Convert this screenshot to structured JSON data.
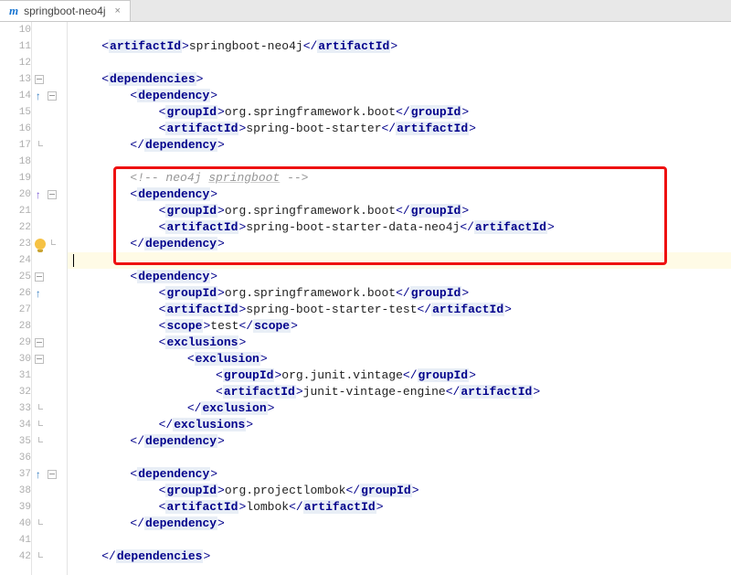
{
  "tab": {
    "icon": "m",
    "title": "springboot-neo4j",
    "close": "×"
  },
  "lines": [
    {
      "n": 10,
      "indent": 0,
      "parts": []
    },
    {
      "n": 11,
      "indent": 1,
      "parts": [
        {
          "k": "br",
          "v": "<"
        },
        {
          "k": "t",
          "v": "artifactId"
        },
        {
          "k": "br",
          "v": ">"
        },
        {
          "k": "tx",
          "v": "springboot-neo4j"
        },
        {
          "k": "br",
          "v": "</"
        },
        {
          "k": "t",
          "v": "artifactId"
        },
        {
          "k": "br",
          "v": ">"
        }
      ]
    },
    {
      "n": 12,
      "indent": 0,
      "parts": []
    },
    {
      "n": 13,
      "indent": 1,
      "fold": "minus",
      "parts": [
        {
          "k": "br",
          "v": "<"
        },
        {
          "k": "t",
          "v": "dependencies"
        },
        {
          "k": "br",
          "v": ">"
        }
      ]
    },
    {
      "n": 14,
      "indent": 2,
      "fold": "minus",
      "icon": "uparrow-blue",
      "parts": [
        {
          "k": "br",
          "v": "<"
        },
        {
          "k": "t",
          "v": "dependency"
        },
        {
          "k": "br",
          "v": ">"
        }
      ]
    },
    {
      "n": 15,
      "indent": 3,
      "parts": [
        {
          "k": "br",
          "v": "<"
        },
        {
          "k": "t",
          "v": "groupId"
        },
        {
          "k": "br",
          "v": ">"
        },
        {
          "k": "tx",
          "v": "org.springframework.boot"
        },
        {
          "k": "br",
          "v": "</"
        },
        {
          "k": "t",
          "v": "groupId"
        },
        {
          "k": "br",
          "v": ">"
        }
      ]
    },
    {
      "n": 16,
      "indent": 3,
      "parts": [
        {
          "k": "br",
          "v": "<"
        },
        {
          "k": "t",
          "v": "artifactId"
        },
        {
          "k": "br",
          "v": ">"
        },
        {
          "k": "tx",
          "v": "spring-boot-starter"
        },
        {
          "k": "br",
          "v": "</"
        },
        {
          "k": "t",
          "v": "artifactId"
        },
        {
          "k": "br",
          "v": ">"
        }
      ]
    },
    {
      "n": 17,
      "indent": 2,
      "foldend": true,
      "parts": [
        {
          "k": "br",
          "v": "</"
        },
        {
          "k": "t",
          "v": "dependency"
        },
        {
          "k": "br",
          "v": ">"
        }
      ]
    },
    {
      "n": 18,
      "indent": 0,
      "parts": []
    },
    {
      "n": 19,
      "indent": 2,
      "parts": [
        {
          "k": "cm",
          "v": "<!-- neo4j "
        },
        {
          "k": "cmu",
          "v": "springboot"
        },
        {
          "k": "cm",
          "v": " -->"
        }
      ]
    },
    {
      "n": 20,
      "indent": 2,
      "fold": "minus",
      "icon": "uparrow-purple",
      "parts": [
        {
          "k": "br",
          "v": "<"
        },
        {
          "k": "t",
          "v": "dependency"
        },
        {
          "k": "br",
          "v": ">"
        }
      ]
    },
    {
      "n": 21,
      "indent": 3,
      "parts": [
        {
          "k": "br",
          "v": "<"
        },
        {
          "k": "t",
          "v": "groupId"
        },
        {
          "k": "br",
          "v": ">"
        },
        {
          "k": "tx",
          "v": "org.springframework.boot"
        },
        {
          "k": "br",
          "v": "</"
        },
        {
          "k": "t",
          "v": "groupId"
        },
        {
          "k": "br",
          "v": ">"
        }
      ]
    },
    {
      "n": 22,
      "indent": 3,
      "parts": [
        {
          "k": "br",
          "v": "<"
        },
        {
          "k": "t",
          "v": "artifactId"
        },
        {
          "k": "br",
          "v": ">"
        },
        {
          "k": "tx",
          "v": "spring-boot-starter-data-neo4j"
        },
        {
          "k": "br",
          "v": "</"
        },
        {
          "k": "t",
          "v": "artifactId"
        },
        {
          "k": "br",
          "v": ">"
        }
      ]
    },
    {
      "n": 23,
      "indent": 2,
      "icon": "bulb",
      "foldend": true,
      "parts": [
        {
          "k": "br",
          "v": "</"
        },
        {
          "k": "t",
          "v": "dependency"
        },
        {
          "k": "br",
          "v": ">"
        }
      ]
    },
    {
      "n": 24,
      "indent": 0,
      "current": true,
      "caret": true,
      "parts": []
    },
    {
      "n": 25,
      "indent": 2,
      "fold": "minus",
      "parts": [
        {
          "k": "br",
          "v": "<"
        },
        {
          "k": "t",
          "v": "dependency"
        },
        {
          "k": "br",
          "v": ">"
        }
      ]
    },
    {
      "n": 26,
      "indent": 3,
      "icon": "uparrow-blue",
      "parts": [
        {
          "k": "br",
          "v": "<"
        },
        {
          "k": "t",
          "v": "groupId"
        },
        {
          "k": "br",
          "v": ">"
        },
        {
          "k": "tx",
          "v": "org.springframework.boot"
        },
        {
          "k": "br",
          "v": "</"
        },
        {
          "k": "t",
          "v": "groupId"
        },
        {
          "k": "br",
          "v": ">"
        }
      ]
    },
    {
      "n": 27,
      "indent": 3,
      "parts": [
        {
          "k": "br",
          "v": "<"
        },
        {
          "k": "t",
          "v": "artifactId"
        },
        {
          "k": "br",
          "v": ">"
        },
        {
          "k": "tx",
          "v": "spring-boot-starter-test"
        },
        {
          "k": "br",
          "v": "</"
        },
        {
          "k": "t",
          "v": "artifactId"
        },
        {
          "k": "br",
          "v": ">"
        }
      ]
    },
    {
      "n": 28,
      "indent": 3,
      "parts": [
        {
          "k": "br",
          "v": "<"
        },
        {
          "k": "t",
          "v": "scope"
        },
        {
          "k": "br",
          "v": ">"
        },
        {
          "k": "tx",
          "v": "test"
        },
        {
          "k": "br",
          "v": "</"
        },
        {
          "k": "t",
          "v": "scope"
        },
        {
          "k": "br",
          "v": ">"
        }
      ]
    },
    {
      "n": 29,
      "indent": 3,
      "fold": "minus",
      "parts": [
        {
          "k": "br",
          "v": "<"
        },
        {
          "k": "t",
          "v": "exclusions"
        },
        {
          "k": "br",
          "v": ">"
        }
      ]
    },
    {
      "n": 30,
      "indent": 4,
      "fold": "minus",
      "parts": [
        {
          "k": "br",
          "v": "<"
        },
        {
          "k": "t",
          "v": "exclusion"
        },
        {
          "k": "br",
          "v": ">"
        }
      ]
    },
    {
      "n": 31,
      "indent": 5,
      "parts": [
        {
          "k": "br",
          "v": "<"
        },
        {
          "k": "t",
          "v": "groupId"
        },
        {
          "k": "br",
          "v": ">"
        },
        {
          "k": "tx",
          "v": "org.junit.vintage"
        },
        {
          "k": "br",
          "v": "</"
        },
        {
          "k": "t",
          "v": "groupId"
        },
        {
          "k": "br",
          "v": ">"
        }
      ]
    },
    {
      "n": 32,
      "indent": 5,
      "parts": [
        {
          "k": "br",
          "v": "<"
        },
        {
          "k": "t",
          "v": "artifactId"
        },
        {
          "k": "br",
          "v": ">"
        },
        {
          "k": "tx",
          "v": "junit-vintage-engine"
        },
        {
          "k": "br",
          "v": "</"
        },
        {
          "k": "t",
          "v": "artifactId"
        },
        {
          "k": "br",
          "v": ">"
        }
      ]
    },
    {
      "n": 33,
      "indent": 4,
      "foldend": true,
      "parts": [
        {
          "k": "br",
          "v": "</"
        },
        {
          "k": "t",
          "v": "exclusion"
        },
        {
          "k": "br",
          "v": ">"
        }
      ]
    },
    {
      "n": 34,
      "indent": 3,
      "foldend": true,
      "parts": [
        {
          "k": "br",
          "v": "</"
        },
        {
          "k": "t",
          "v": "exclusions"
        },
        {
          "k": "br",
          "v": ">"
        }
      ]
    },
    {
      "n": 35,
      "indent": 2,
      "foldend": true,
      "parts": [
        {
          "k": "br",
          "v": "</"
        },
        {
          "k": "t",
          "v": "dependency"
        },
        {
          "k": "br",
          "v": ">"
        }
      ]
    },
    {
      "n": 36,
      "indent": 0,
      "parts": []
    },
    {
      "n": 37,
      "indent": 2,
      "fold": "minus",
      "icon": "uparrow-blue",
      "parts": [
        {
          "k": "br",
          "v": "<"
        },
        {
          "k": "t",
          "v": "dependency"
        },
        {
          "k": "br",
          "v": ">"
        }
      ]
    },
    {
      "n": 38,
      "indent": 3,
      "parts": [
        {
          "k": "br",
          "v": "<"
        },
        {
          "k": "t",
          "v": "groupId"
        },
        {
          "k": "br",
          "v": ">"
        },
        {
          "k": "tx",
          "v": "org.projectlombok"
        },
        {
          "k": "br",
          "v": "</"
        },
        {
          "k": "t",
          "v": "groupId"
        },
        {
          "k": "br",
          "v": ">"
        }
      ]
    },
    {
      "n": 39,
      "indent": 3,
      "parts": [
        {
          "k": "br",
          "v": "<"
        },
        {
          "k": "t",
          "v": "artifactId"
        },
        {
          "k": "br",
          "v": ">"
        },
        {
          "k": "tx",
          "v": "lombok"
        },
        {
          "k": "br",
          "v": "</"
        },
        {
          "k": "t",
          "v": "artifactId"
        },
        {
          "k": "br",
          "v": ">"
        }
      ]
    },
    {
      "n": 40,
      "indent": 2,
      "foldend": true,
      "parts": [
        {
          "k": "br",
          "v": "</"
        },
        {
          "k": "t",
          "v": "dependency"
        },
        {
          "k": "br",
          "v": ">"
        }
      ]
    },
    {
      "n": 41,
      "indent": 0,
      "parts": []
    },
    {
      "n": 42,
      "indent": 1,
      "foldend": true,
      "parts": [
        {
          "k": "br",
          "v": "</"
        },
        {
          "k": "t",
          "v": "dependencies"
        },
        {
          "k": "br",
          "v": ">"
        }
      ]
    }
  ],
  "highlight": {
    "first_line": 19,
    "last_line": 23
  }
}
